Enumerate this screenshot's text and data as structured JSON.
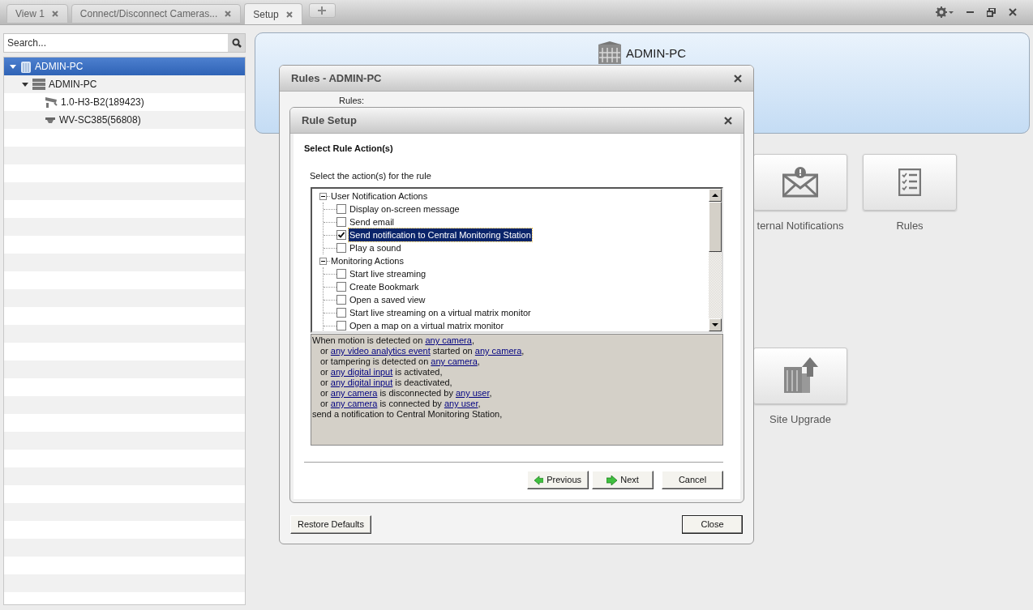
{
  "tabs": [
    {
      "label": "View 1",
      "selected": false
    },
    {
      "label": "Connect/Disconnect Cameras...",
      "selected": false
    },
    {
      "label": "Setup",
      "selected": true
    }
  ],
  "search": {
    "placeholder": "Search..."
  },
  "device_tree": [
    {
      "label": "ADMIN-PC",
      "kind": "site",
      "selected": true,
      "expanded": true,
      "children": [
        {
          "label": "ADMIN-PC",
          "kind": "server",
          "selected": false,
          "expanded": true,
          "children": [
            {
              "label": "1.0-H3-B2(189423)",
              "kind": "camera",
              "selected": false
            },
            {
              "label": "WV-SC385(56808)",
              "kind": "dome",
              "selected": false
            }
          ]
        }
      ]
    }
  ],
  "site_header": {
    "title": "ADMIN-PC"
  },
  "tile_rows": [
    [
      {
        "label": "ternal Notifications",
        "kind": "notifications"
      },
      {
        "label": "Rules",
        "kind": "rules"
      }
    ],
    [
      {
        "label": "Site Upgrade",
        "kind": "upgrade"
      }
    ]
  ],
  "rules_dialog": {
    "title": "Rules - ADMIN-PC",
    "rules_label": "Rules:",
    "buttons": [
      {
        "label": "Restore Defaults",
        "kind": "restore"
      },
      {
        "label": "Close",
        "kind": "close"
      }
    ]
  },
  "rule_setup": {
    "title": "Rule Setup",
    "heading": "Select Rule Action(s)",
    "prompt": "Select the action(s) for the rule",
    "action_groups": [
      {
        "label": "User Notification Actions",
        "expanded": true,
        "children": [
          {
            "label": "Display on-screen message",
            "checked": false,
            "selected": false
          },
          {
            "label": "Send email",
            "checked": false,
            "selected": false
          },
          {
            "label": "Send notification to Central Monitoring Station",
            "checked": true,
            "selected": true
          },
          {
            "label": "Play a sound",
            "checked": false,
            "selected": false
          }
        ]
      },
      {
        "label": "Monitoring Actions",
        "expanded": true,
        "children": [
          {
            "label": "Start live streaming",
            "checked": false,
            "selected": false
          },
          {
            "label": "Create Bookmark",
            "checked": false,
            "selected": false
          },
          {
            "label": "Open a saved view",
            "checked": false,
            "selected": false
          },
          {
            "label": "Start live streaming on a virtual matrix monitor",
            "checked": false,
            "selected": false
          },
          {
            "label": "Open a map on a virtual matrix monitor",
            "checked": false,
            "selected": false
          }
        ]
      }
    ],
    "description": [
      {
        "indented": false,
        "parts": [
          {
            "text": "When motion is detected on ",
            "link": false
          },
          {
            "text": "any camera",
            "link": true
          },
          {
            "text": ",",
            "link": false
          }
        ]
      },
      {
        "indented": true,
        "parts": [
          {
            "text": "or ",
            "link": false
          },
          {
            "text": "any video analytics event",
            "link": true
          },
          {
            "text": " started on ",
            "link": false
          },
          {
            "text": "any camera",
            "link": true
          },
          {
            "text": ",",
            "link": false
          }
        ]
      },
      {
        "indented": true,
        "parts": [
          {
            "text": "or tampering is detected on ",
            "link": false
          },
          {
            "text": "any camera",
            "link": true
          },
          {
            "text": ",",
            "link": false
          }
        ]
      },
      {
        "indented": true,
        "parts": [
          {
            "text": "or ",
            "link": false
          },
          {
            "text": "any digital input",
            "link": true
          },
          {
            "text": " is activated,",
            "link": false
          }
        ]
      },
      {
        "indented": true,
        "parts": [
          {
            "text": "or ",
            "link": false
          },
          {
            "text": "any digital input",
            "link": true
          },
          {
            "text": " is deactivated,",
            "link": false
          }
        ]
      },
      {
        "indented": true,
        "parts": [
          {
            "text": "or ",
            "link": false
          },
          {
            "text": "any camera",
            "link": true
          },
          {
            "text": " is disconnected by ",
            "link": false
          },
          {
            "text": "any user",
            "link": true
          },
          {
            "text": ",",
            "link": false
          }
        ]
      },
      {
        "indented": true,
        "parts": [
          {
            "text": "or ",
            "link": false
          },
          {
            "text": "any camera",
            "link": true
          },
          {
            "text": " is connected by ",
            "link": false
          },
          {
            "text": "any user",
            "link": true
          },
          {
            "text": ",",
            "link": false
          }
        ]
      },
      {
        "indented": false,
        "parts": [
          {
            "text": "send a notification to Central Monitoring Station,",
            "link": false
          }
        ]
      }
    ],
    "buttons": [
      {
        "label": "Previous",
        "kind": "previous"
      },
      {
        "label": "Next",
        "kind": "next"
      },
      {
        "label": "Cancel",
        "kind": "cancel"
      }
    ]
  }
}
